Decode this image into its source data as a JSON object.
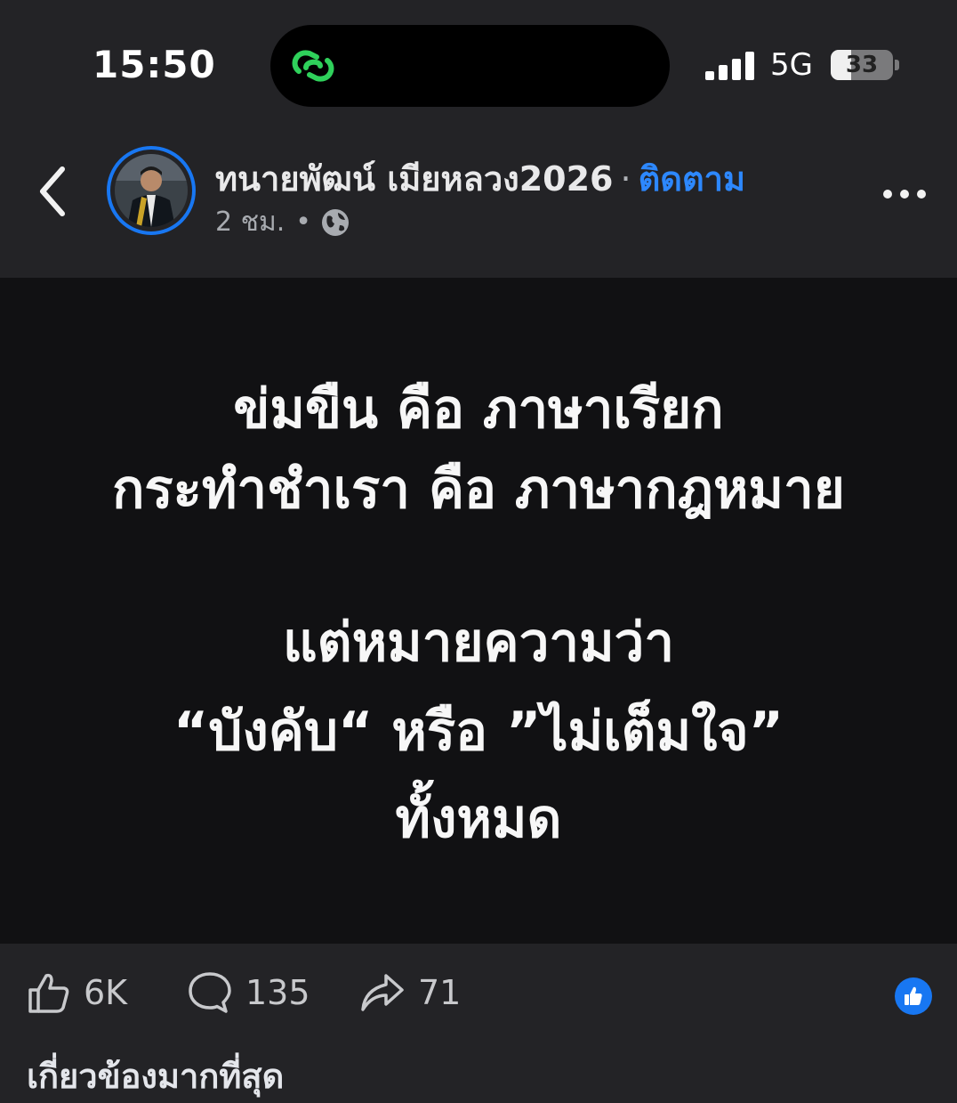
{
  "status_bar": {
    "time": "15:50",
    "network": "5G",
    "battery_level": "33",
    "battery_fraction": 0.33,
    "island_icon": "link-loop-icon",
    "island_icon_color": "#2fd15b"
  },
  "post": {
    "author": "ทนายพัฒน์ เมียหลวง2026",
    "separator": "·",
    "follow_label": "ติดตาม",
    "time_ago": "2 ชม.",
    "meta_separator": "•",
    "audience_icon": "globe-icon",
    "accent_color": "#1877f2",
    "image_text_lines": [
      "ข่มขืน คือ ภาษาเรียก",
      "กระทำชำเรา คือ ภาษากฎหมาย",
      "",
      "แต่หมายความว่า",
      "“บังคับ“ หรือ ”ไม่เต็มใจ”",
      "ทั้งหมด"
    ]
  },
  "actions": {
    "likes": "6K",
    "comments": "135",
    "shares": "71"
  },
  "below": {
    "sort_label": "เกี่ยวข้องมากที่สุด"
  }
}
